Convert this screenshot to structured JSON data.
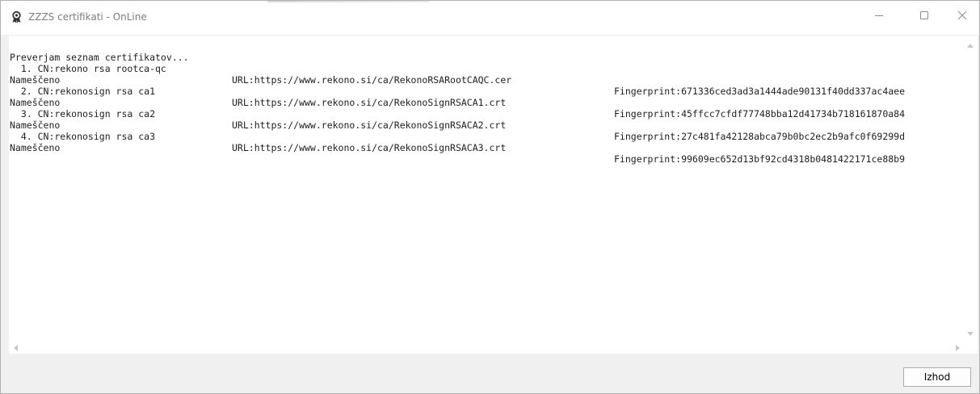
{
  "window": {
    "title": "ZZZS certifikati - OnLine",
    "icons": [
      "app-icon",
      "minimize-icon",
      "maximize-icon",
      "close-icon"
    ]
  },
  "output": {
    "header": "Preverjam seznam certifikatov...",
    "entries": [
      {
        "cn": "  1. CN:rekono rsa rootca-qc",
        "url": "URL:https://www.rekono.si/ca/RekonoRSARootCAQC.cer",
        "fingerprint": "Fingerprint:671336ced3ad3a1444ade90131f40dd337ac4aee",
        "status": "Nameščeno"
      },
      {
        "cn": "  2. CN:rekonosign rsa ca1",
        "url": "URL:https://www.rekono.si/ca/RekonoSignRSACA1.crt",
        "fingerprint": "Fingerprint:45ffcc7cfdf77748bba12d41734b718161870a84",
        "status": "Nameščeno"
      },
      {
        "cn": "  3. CN:rekonosign rsa ca2",
        "url": "URL:https://www.rekono.si/ca/RekonoSignRSACA2.crt",
        "fingerprint": "Fingerprint:27c481fa42128abca79b0bc2ec2b9afc0f69299d",
        "status": "Nameščeno"
      },
      {
        "cn": "  4. CN:rekonosign rsa ca3",
        "url": "URL:https://www.rekono.si/ca/RekonoSignRSACA3.crt",
        "fingerprint": "Fingerprint:99609ec652d13bf92cd4318b0481422171ce88b9",
        "status": "Nameščeno"
      }
    ]
  },
  "footer": {
    "exit_label": "Izhod"
  }
}
